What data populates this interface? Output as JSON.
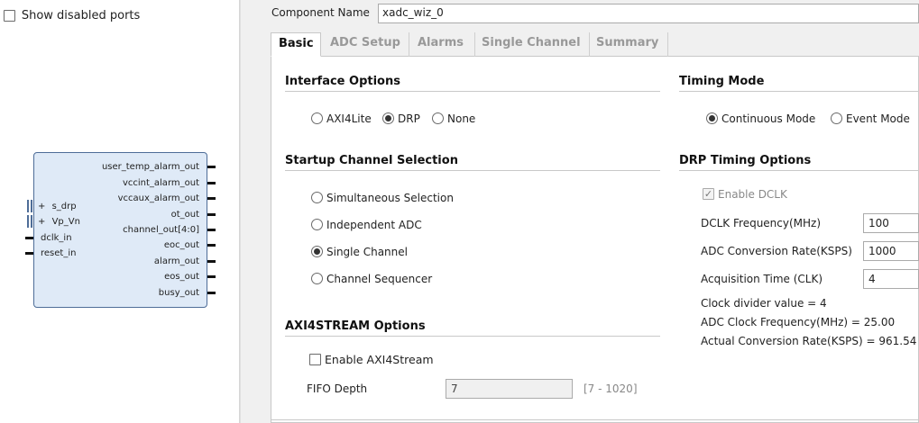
{
  "left_panel": {
    "show_disabled_ports": {
      "label": "Show disabled ports",
      "checked": false
    },
    "block": {
      "right_ports": [
        "user_temp_alarm_out",
        "vccint_alarm_out",
        "vccaux_alarm_out",
        "ot_out",
        "channel_out[4:0]",
        "eoc_out",
        "alarm_out",
        "eos_out",
        "busy_out"
      ],
      "left_bus_ports": [
        "s_drp",
        "Vp_Vn"
      ],
      "left_ports": [
        "dclk_in",
        "reset_in"
      ],
      "expand_symbol": "+"
    }
  },
  "component": {
    "label": "Component Name",
    "value": "xadc_wiz_0"
  },
  "tabs": [
    "Basic",
    "ADC Setup",
    "Alarms",
    "Single Channel",
    "Summary"
  ],
  "active_tab": "Basic",
  "interface_options": {
    "title": "Interface Options",
    "options": [
      "AXI4Lite",
      "DRP",
      "None"
    ],
    "selected": "DRP"
  },
  "timing_mode": {
    "title": "Timing Mode",
    "options": [
      "Continuous Mode",
      "Event Mode"
    ],
    "selected": "Continuous Mode"
  },
  "startup_channel": {
    "title": "Startup Channel Selection",
    "options": [
      "Simultaneous Selection",
      "Independent ADC",
      "Single Channel",
      "Channel Sequencer"
    ],
    "selected": "Single Channel"
  },
  "drp_timing": {
    "title": "DRP Timing Options",
    "enable_dclk": {
      "label": "Enable DCLK",
      "checked": true,
      "disabled": true
    },
    "dclk_freq": {
      "label": "DCLK Frequency(MHz)",
      "value": "100"
    },
    "adc_rate": {
      "label": "ADC Conversion Rate(KSPS)",
      "value": "1000"
    },
    "acq_time": {
      "label": "Acquisition Time (CLK)",
      "value": "4"
    },
    "clock_divider": "Clock divider value = 4",
    "adc_clock": "ADC Clock Frequency(MHz) = 25.00",
    "actual_rate": "Actual Conversion Rate(KSPS) = 961.54"
  },
  "axi4stream": {
    "title": "AXI4STREAM Options",
    "enable": {
      "label": "Enable AXI4Stream",
      "checked": false
    },
    "fifo_label": "FIFO Depth",
    "fifo_value": "7",
    "fifo_range": "[7 - 1020]"
  }
}
